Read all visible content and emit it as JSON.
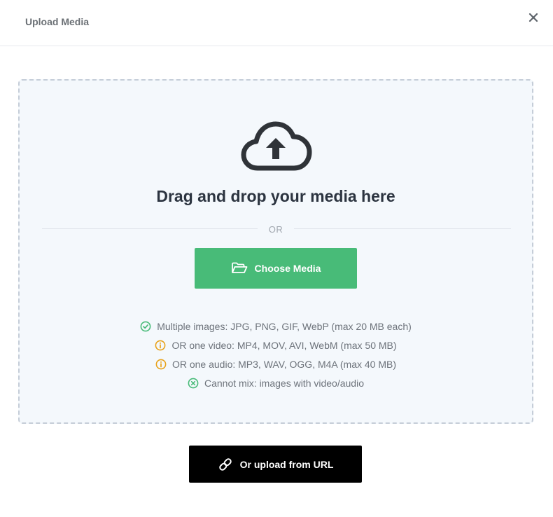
{
  "header": {
    "title": "Upload Media",
    "close_icon": "close-icon"
  },
  "dropzone": {
    "icon": "cloud-upload-icon",
    "heading": "Drag and drop your media here",
    "divider_text": "OR",
    "choose_button": {
      "label": "Choose Media",
      "icon": "folder-open-icon"
    },
    "rules": [
      {
        "icon": "check-circle-icon",
        "color": "#48bb78",
        "text": "Multiple images: JPG, PNG, GIF, WebP (max 20 MB each)"
      },
      {
        "icon": "info-circle-icon",
        "color": "#e8a21a",
        "text": "OR one video: MP4, MOV, AVI, WebM (max 50 MB)"
      },
      {
        "icon": "info-circle-icon",
        "color": "#e8a21a",
        "text": "OR one audio: MP3, WAV, OGG, M4A (max 40 MB)"
      },
      {
        "icon": "x-circle-icon",
        "color": "#48bb78",
        "text": "Cannot mix: images with video/audio"
      }
    ]
  },
  "url_button": {
    "label": "Or upload from URL",
    "icon": "link-icon"
  },
  "colors": {
    "accent_green": "#48bb78",
    "warning_orange": "#e8a21a",
    "dropzone_bg": "#f4f8fc",
    "heading_text": "#2c3440"
  }
}
